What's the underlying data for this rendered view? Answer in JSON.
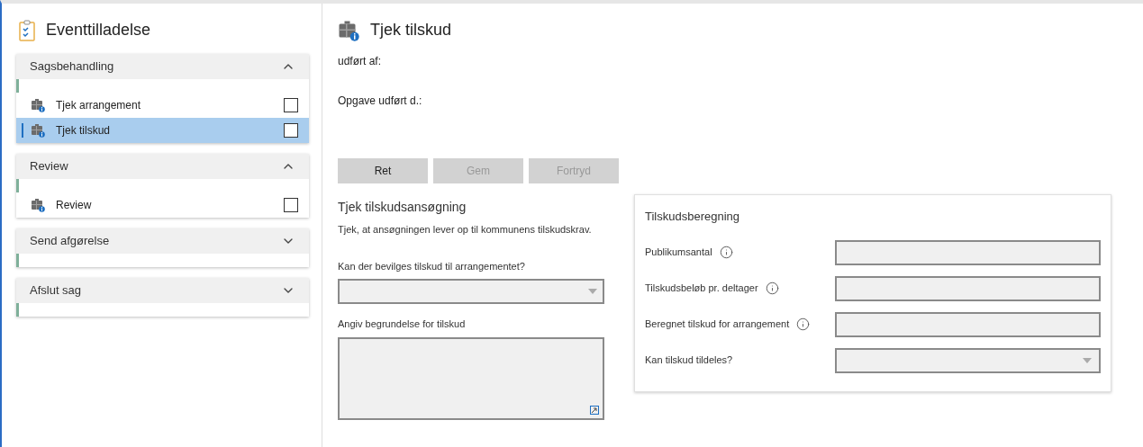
{
  "sidebar": {
    "title": "Eventtilladelse",
    "sections": [
      {
        "title": "Sagsbehandling",
        "expanded": true,
        "items": [
          {
            "label": "Tjek arrangement",
            "checked": false,
            "selected": false
          },
          {
            "label": "Tjek tilskud",
            "checked": false,
            "selected": true
          }
        ]
      },
      {
        "title": "Review",
        "expanded": true,
        "items": [
          {
            "label": "Review",
            "checked": false,
            "selected": false
          }
        ]
      },
      {
        "title": "Send afgørelse",
        "expanded": false
      },
      {
        "title": "Afslut sag",
        "expanded": false
      }
    ]
  },
  "task": {
    "title": "Tjek tilskud",
    "done_by": "udført af:",
    "done_date": "Opgave udført d.:",
    "buttons": [
      {
        "label": "Ret",
        "disabled": false
      },
      {
        "label": "Gem",
        "disabled": true
      },
      {
        "label": "Fortryd",
        "disabled": true
      }
    ]
  },
  "application": {
    "title": "Tjek tilskudsansøgning",
    "description": "Tjek, at ansøgningen lever op til kommunens tilskudskrav.",
    "grant_question": "Kan der bevilges tilskud til arrangementet?",
    "reason_label": "Angiv begrundelse for tilskud"
  },
  "calculation": {
    "title": "Tilskudsberegning",
    "fields": [
      {
        "label": "Publikumsantal",
        "kind": "text",
        "info": true
      },
      {
        "label": "Tilskudsbeløb pr. deltager",
        "kind": "text",
        "info": true
      },
      {
        "label": "Beregnet tilskud for arrangement",
        "kind": "text",
        "info": true
      },
      {
        "label": "Kan tilskud tildeles?",
        "kind": "select",
        "info": false
      }
    ]
  }
}
